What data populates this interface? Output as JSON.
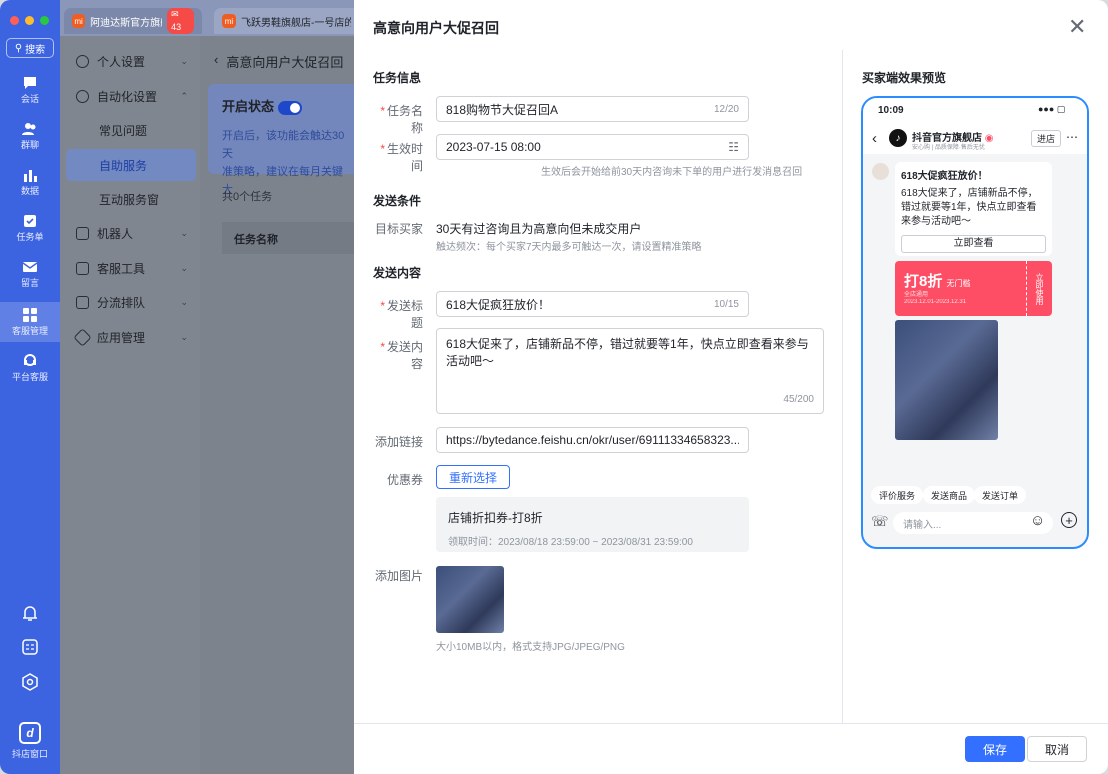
{
  "tabs": [
    {
      "label": "阿迪达斯官方旗舰店",
      "badge": "43",
      "icon": "mi"
    },
    {
      "label": "飞跃男鞋旗舰店-一号店的",
      "icon": "mi"
    }
  ],
  "rail": {
    "search": "搜索",
    "items": [
      {
        "label": "会话",
        "icon": "chat-icon"
      },
      {
        "label": "群聊",
        "icon": "group-icon"
      },
      {
        "label": "数据",
        "icon": "chart-icon"
      },
      {
        "label": "任务单",
        "icon": "task-icon"
      },
      {
        "label": "留言",
        "icon": "mail-icon"
      },
      {
        "label": "客服管理",
        "icon": "grid-icon"
      },
      {
        "label": "平台客服",
        "icon": "headset-icon"
      }
    ],
    "logo_label": "抖店窗口"
  },
  "menu": {
    "items": [
      {
        "label": "个人设置"
      },
      {
        "label": "自动化设置"
      },
      {
        "label": "常见问题",
        "sub": true
      },
      {
        "label": "自助服务",
        "sub": true,
        "selected": true
      },
      {
        "label": "互动服务窗",
        "sub": true
      },
      {
        "label": "机器人"
      },
      {
        "label": "客服工具"
      },
      {
        "label": "分流排队"
      },
      {
        "label": "应用管理"
      }
    ]
  },
  "bg": {
    "back_title": "高意向用户大促召回",
    "status_label": "开启状态",
    "desc1": "开启后，该功能会触达30天",
    "desc2": "准策略，建议在每月关键大",
    "task_count": "共0个任务",
    "col_name": "任务名称"
  },
  "modal": {
    "title": "高意向用户大促召回",
    "sec_info": "任务信息",
    "name_label": "任务名称",
    "name_value": "818购物节大促召回A",
    "name_count": "12/20",
    "time_label": "生效时间",
    "time_value": "2023-07-15 08:00",
    "time_hint": "生效后会开始给前30天内咨询未下单的用户进行发消息召回",
    "sec_cond": "发送条件",
    "target_label": "目标买家",
    "target_value": "30天有过咨询且为高意向但未成交用户",
    "target_hint": "触达频次：每个买家7天内最多可触达一次，请设置精准策略",
    "sec_content": "发送内容",
    "subject_label": "发送标题",
    "subject_value": "618大促疯狂放价！",
    "subject_count": "10/15",
    "content_label": "发送内容",
    "content_value": "618大促来了，店铺新品不停，错过就要等1年，快点立即查看来参与活动吧～",
    "content_count": "45/200",
    "link_label": "添加链接",
    "link_value": "https://bytedance.feishu.cn/okr/user/69111334658323...",
    "coupon_label": "优惠券",
    "reselect": "重新选择",
    "coupon_name": "店铺折扣券-打8折",
    "coupon_time": "领取时间：2023/08/18 23:59:00 ~ 2023/08/31 23:59:00",
    "image_label": "添加图片",
    "image_hint": "大小10MB以内，格式支持JPG/JPEG/PNG",
    "save": "保存",
    "cancel": "取消"
  },
  "preview": {
    "title": "买家端效果预览",
    "time": "10:09",
    "shop": "抖音官方旗舰店",
    "shop_sub": "安心购 | 品质保障·售后无忧",
    "enter": "进店",
    "msg_title": "618大促疯狂放价！",
    "msg_body": "618大促来了，店铺新品不停，错过就要等1年，快点立即查看来参与活动吧～",
    "view_btn": "立即查看",
    "coupon_big": "打8折",
    "coupon_tag": "无门槛",
    "coupon_scope": "全店通用",
    "coupon_dates": "2023.12.01-2023.12.31",
    "coupon_use": "立即使用",
    "quick": [
      "评价服务",
      "发送商品",
      "发送订单"
    ],
    "input_ph": "请输入..."
  },
  "colors": {
    "accent": "#3370ff",
    "rail": "#3d64e0",
    "coupon": "#fe4e66",
    "required": "#f54a45"
  }
}
